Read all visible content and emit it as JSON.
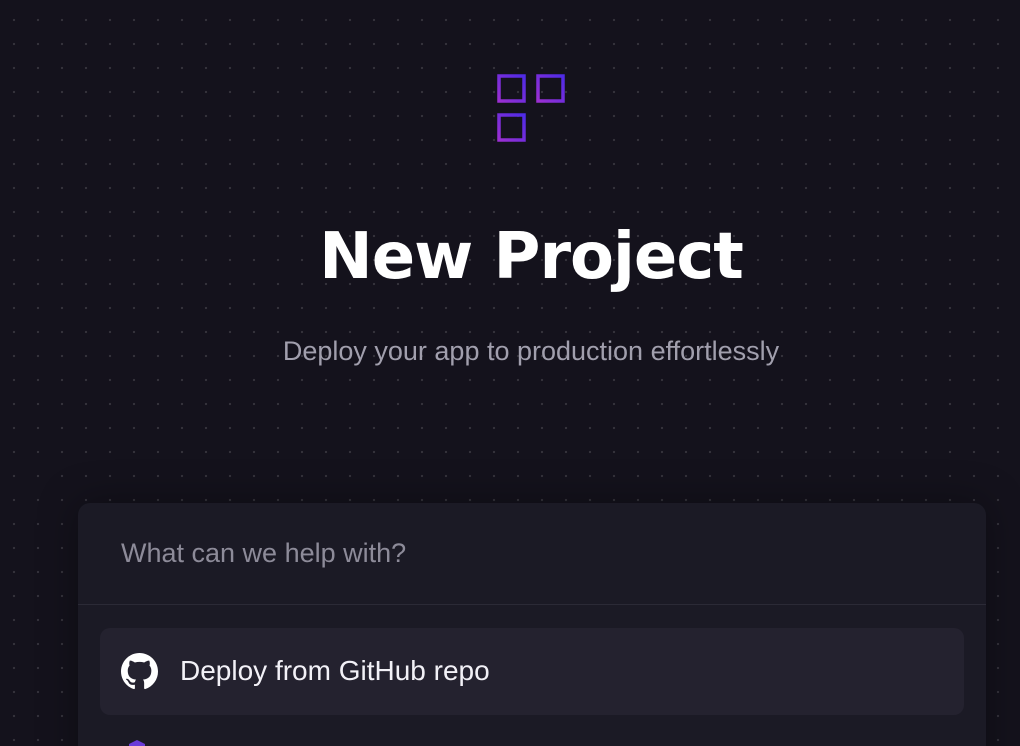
{
  "hero": {
    "icon": "add-app-grid-icon",
    "title": "New Project",
    "subtitle": "Deploy your app to production effortlessly"
  },
  "search": {
    "placeholder": "What can we help with?",
    "value": ""
  },
  "options": [
    {
      "icon": "github-icon",
      "label": "Deploy from GitHub repo"
    },
    {
      "icon": "database-icon",
      "label": ""
    }
  ],
  "colors": {
    "background": "#14121c",
    "panel": "#1b1a25",
    "option_bg": "#24222f",
    "accent_purple": "#8b2fd6",
    "accent_violet": "#5b28e0",
    "subtitle_text": "#a19fad"
  }
}
